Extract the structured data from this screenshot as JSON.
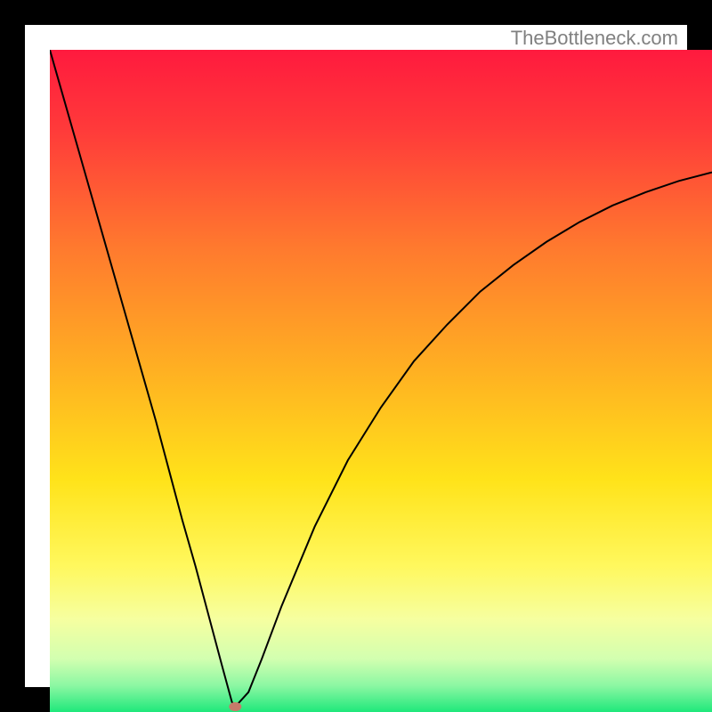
{
  "watermark": "TheBottleneck.com",
  "chart_data": {
    "type": "line",
    "title": "",
    "xlabel": "",
    "ylabel": "",
    "xlim": [
      0,
      100
    ],
    "ylim": [
      0,
      100
    ],
    "background_gradient_note": "vertical gradient red→orange→yellow→green representing bottleneck severity; low values (green) at bottom, high (red) at top",
    "curve": {
      "description": "V-shaped bottleneck curve; minimum near x≈28",
      "x": [
        0,
        2,
        4,
        6,
        8,
        10,
        12,
        14,
        16,
        18,
        20,
        22,
        24,
        26,
        27.5,
        28,
        30,
        32,
        35,
        40,
        45,
        50,
        55,
        60,
        65,
        70,
        75,
        80,
        85,
        90,
        95,
        100
      ],
      "y": [
        100,
        93,
        86,
        79,
        72,
        65,
        58,
        51,
        44,
        36.5,
        29,
        22,
        14.5,
        7,
        1.5,
        0.8,
        3,
        8,
        16,
        28,
        38,
        46,
        53,
        58.5,
        63.5,
        67.5,
        71,
        74,
        76.5,
        78.5,
        80.2,
        81.5
      ]
    },
    "marker": {
      "x": 28,
      "y": 0.8,
      "color": "#c67a6a",
      "description": "optimal/zero-bottleneck point"
    }
  }
}
